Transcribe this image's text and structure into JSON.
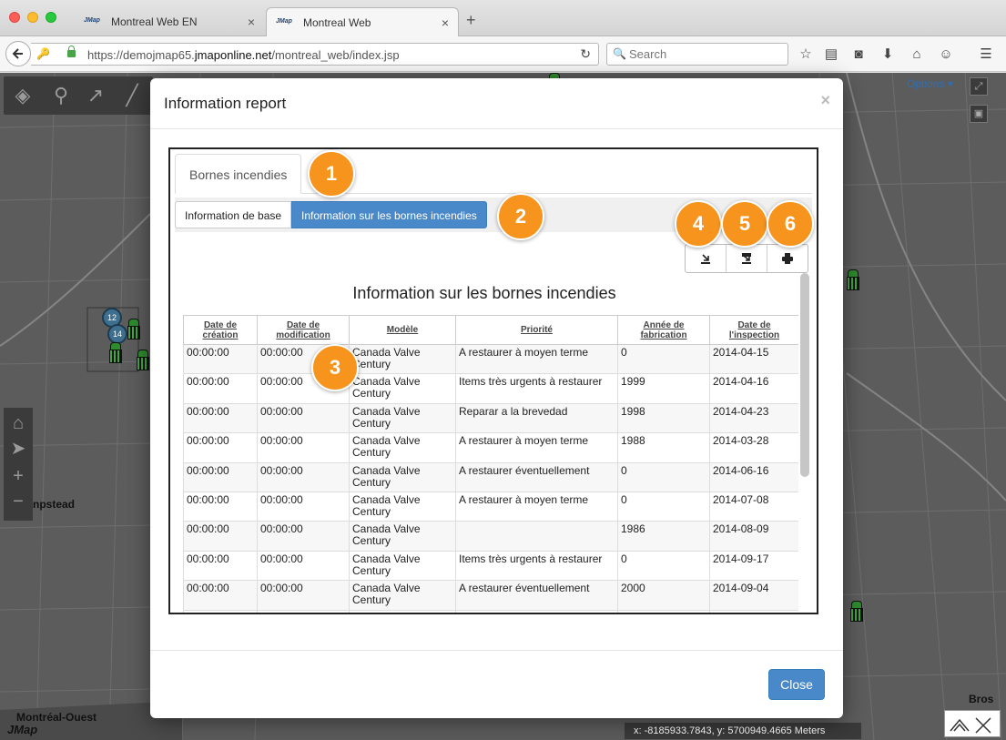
{
  "browser": {
    "tabs": [
      {
        "label": "Montreal Web EN",
        "favicon": "JMap",
        "active": false
      },
      {
        "label": "Montreal Web",
        "favicon": "JMap",
        "active": true
      }
    ],
    "url_prefix": "https://demojmap65.",
    "url_domain": "jmaponline.net",
    "url_path": "/montreal_web/index.jsp",
    "search_placeholder": "Search"
  },
  "map": {
    "options_label": "Options",
    "labels": {
      "hampstead": "npstead",
      "montreal_ouest": "Montréal-Ouest",
      "brossard": "Bros"
    },
    "logo": "JMap",
    "coordinates": "x: -8185933.7843, y: 5700949.4665 Meters",
    "cluster_counts": [
      "12",
      "14"
    ]
  },
  "modal": {
    "title": "Information report",
    "close_symbol": "×",
    "main_tab": "Bornes incendies",
    "subtabs": {
      "base": "Information de base",
      "fire": "Information sur les bornes incendies"
    },
    "report_title": "Information sur les bornes incendies",
    "close_button": "Close",
    "markers": [
      "1",
      "2",
      "3",
      "4",
      "5",
      "6"
    ]
  },
  "table": {
    "headers": [
      [
        "Date de",
        "création"
      ],
      [
        "Date de",
        "modification"
      ],
      [
        "Modèle",
        ""
      ],
      [
        "Priorité",
        ""
      ],
      [
        "Année de",
        "fabrication"
      ],
      [
        "Date de",
        "l'inspection"
      ]
    ],
    "rows": [
      [
        "00:00:00",
        "00:00:00",
        "Canada Valve Century",
        "A restaurer à moyen terme",
        "0",
        "2014-04-15"
      ],
      [
        "00:00:00",
        "00:00:00",
        "Canada Valve Century",
        "Items très urgents à restaurer",
        "1999",
        "2014-04-16"
      ],
      [
        "00:00:00",
        "00:00:00",
        "Canada Valve Century",
        "Reparar a la brevedad",
        "1998",
        "2014-04-23"
      ],
      [
        "00:00:00",
        "00:00:00",
        "Canada Valve Century",
        "A restaurer à moyen terme",
        "1988",
        "2014-03-28"
      ],
      [
        "00:00:00",
        "00:00:00",
        "Canada Valve Century",
        "A restaurer éventuellement",
        "0",
        "2014-06-16"
      ],
      [
        "00:00:00",
        "00:00:00",
        "Canada Valve Century",
        "A restaurer à moyen terme",
        "0",
        "2014-07-08"
      ],
      [
        "00:00:00",
        "00:00:00",
        "Canada Valve Century",
        "",
        "1986",
        "2014-08-09"
      ],
      [
        "00:00:00",
        "00:00:00",
        "Canada Valve Century",
        "Items très urgents à restaurer",
        "0",
        "2014-09-17"
      ],
      [
        "00:00:00",
        "00:00:00",
        "Canada Valve Century",
        "A restaurer éventuellement",
        "2000",
        "2014-09-04"
      ],
      [
        "",
        "",
        "",
        "",
        "",
        ""
      ]
    ]
  },
  "colors": {
    "accent": "#4a89c9",
    "marker": "#f7941d",
    "map_bg": "#5c5c5c"
  }
}
